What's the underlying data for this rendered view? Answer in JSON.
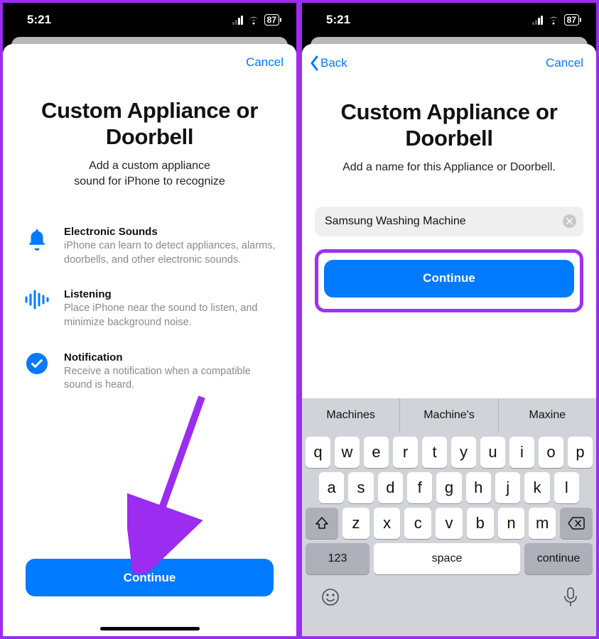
{
  "status": {
    "time": "5:21",
    "battery": "87"
  },
  "left": {
    "cancel": "Cancel",
    "title": "Custom Appliance or Doorbell",
    "subtitle1": "Add a custom appliance",
    "subtitle2": "sound for iPhone to recognize",
    "features": [
      {
        "title": "Electronic Sounds",
        "desc": "iPhone can learn to detect appliances, alarms, doorbells, and other electronic sounds."
      },
      {
        "title": "Listening",
        "desc": "Place iPhone near the sound to listen, and minimize background noise."
      },
      {
        "title": "Notification",
        "desc": "Receive a notification when a compatible sound is heard."
      }
    ],
    "continue": "Continue"
  },
  "right": {
    "back": "Back",
    "cancel": "Cancel",
    "title": "Custom Appliance or Doorbell",
    "subtitle": "Add a name for this Appliance or Doorbell.",
    "input_value": "Samsung Washing Machine",
    "continue": "Continue",
    "suggestions": [
      "Machines",
      "Machine's",
      "Maxine"
    ],
    "rows": {
      "r1": [
        "q",
        "w",
        "e",
        "r",
        "t",
        "y",
        "u",
        "i",
        "o",
        "p"
      ],
      "r2": [
        "a",
        "s",
        "d",
        "f",
        "g",
        "h",
        "j",
        "k",
        "l"
      ],
      "r3": [
        "z",
        "x",
        "c",
        "v",
        "b",
        "n",
        "m"
      ]
    },
    "num": "123",
    "space": "space",
    "return": "continue"
  }
}
